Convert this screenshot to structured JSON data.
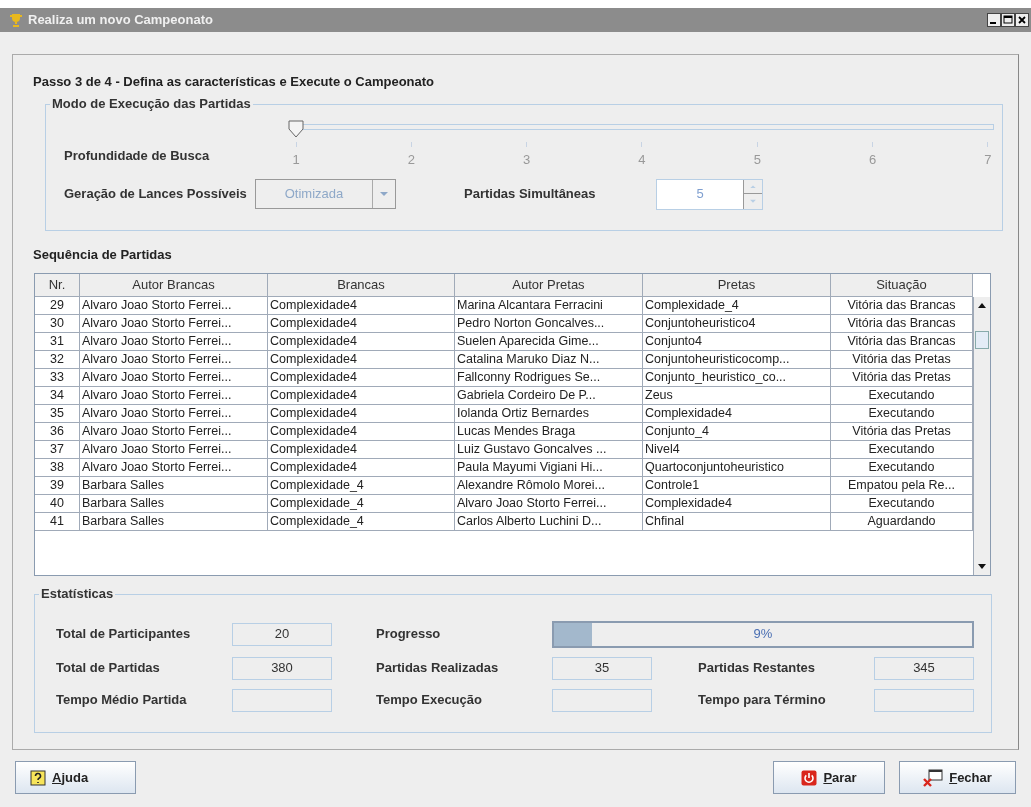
{
  "window": {
    "title": "Realiza um novo Campeonato"
  },
  "step_title": "Passo 3 de 4 - Defina as características e Execute o Campeonato",
  "execution_mode": {
    "legend": "Modo de Execução das Partidas",
    "search_depth": {
      "label": "Profundidade de Busca",
      "level": 0,
      "ticks": [
        "1",
        "2",
        "3",
        "4",
        "5",
        "6",
        "7"
      ]
    },
    "move_generation": {
      "label": "Geração de Lances Possíveis",
      "value": "Otimizada",
      "disabled": true
    },
    "simultaneous": {
      "label": "Partidas Simultâneas",
      "value": "5"
    }
  },
  "matches": {
    "title": "Sequência de Partidas",
    "columns": [
      "Nr.",
      "Autor Brancas",
      "Brancas",
      "Autor Pretas",
      "Pretas",
      "Situação"
    ],
    "rows": [
      [
        "29",
        "Alvaro Joao Storto Ferrei...",
        "Complexidade4",
        "Marina Alcantara Ferracini",
        "Complexidade_4",
        "Vitória das Brancas"
      ],
      [
        "30",
        "Alvaro Joao Storto Ferrei...",
        "Complexidade4",
        "Pedro Norton Goncalves...",
        "Conjuntoheuristico4",
        "Vitória das Brancas"
      ],
      [
        "31",
        "Alvaro Joao Storto Ferrei...",
        "Complexidade4",
        "Suelen Aparecida Gime...",
        "Conjunto4",
        "Vitória das Brancas"
      ],
      [
        "32",
        "Alvaro Joao Storto Ferrei...",
        "Complexidade4",
        "Catalina Maruko Diaz N...",
        "Conjuntoheuristicocomp...",
        "Vitória das Pretas"
      ],
      [
        "33",
        "Alvaro Joao Storto Ferrei...",
        "Complexidade4",
        "Fallconny Rodrigues Se...",
        "Conjunto_heuristico_co...",
        "Vitória das Pretas"
      ],
      [
        "34",
        "Alvaro Joao Storto Ferrei...",
        "Complexidade4",
        "Gabriela Cordeiro De P...",
        "Zeus",
        "Executando"
      ],
      [
        "35",
        "Alvaro Joao Storto Ferrei...",
        "Complexidade4",
        "Iolanda Ortiz Bernardes",
        "Complexidade4",
        "Executando"
      ],
      [
        "36",
        "Alvaro Joao Storto Ferrei...",
        "Complexidade4",
        "Lucas Mendes Braga",
        "Conjunto_4",
        "Vitória das Pretas"
      ],
      [
        "37",
        "Alvaro Joao Storto Ferrei...",
        "Complexidade4",
        "Luiz Gustavo Goncalves ...",
        "Nivel4",
        "Executando"
      ],
      [
        "38",
        "Alvaro Joao Storto Ferrei...",
        "Complexidade4",
        "Paula Mayumi Vigiani Hi...",
        "Quartoconjuntoheuristico",
        "Executando"
      ],
      [
        "39",
        "Barbara Salles",
        "Complexidade_4",
        "Alexandre Rômolo Morei...",
        "Controle1",
        "Empatou pela Re..."
      ],
      [
        "40",
        "Barbara Salles",
        "Complexidade_4",
        "Alvaro Joao Storto Ferrei...",
        "Complexidade4",
        "Executando"
      ],
      [
        "41",
        "Barbara Salles",
        "Complexidade_4",
        "Carlos Alberto Luchini D...",
        "Chfinal",
        "Aguardando"
      ]
    ]
  },
  "statistics": {
    "legend": "Estatísticas",
    "rows": [
      [
        {
          "kind": "field",
          "label": "Total de Participantes",
          "value": "20"
        },
        {
          "kind": "progress",
          "label": "Progresso",
          "level": 0.09,
          "reading": "9%"
        }
      ],
      [
        {
          "kind": "field",
          "label": "Total de Partidas",
          "value": "380"
        },
        {
          "kind": "field",
          "label": "Partidas Realizadas",
          "value": "35"
        },
        {
          "kind": "field",
          "label": "Partidas Restantes",
          "value": "345"
        }
      ],
      [
        {
          "kind": "field",
          "label": "Tempo Médio Partida"
        },
        {
          "kind": "field",
          "label": "Tempo Execução"
        },
        {
          "kind": "field",
          "label": "Tempo para Término"
        }
      ]
    ]
  },
  "buttons": [
    {
      "kind": "help",
      "label": "Ajuda"
    },
    {
      "kind": "stop",
      "label": "Parar"
    },
    {
      "kind": "close",
      "label": "Fechar"
    }
  ]
}
